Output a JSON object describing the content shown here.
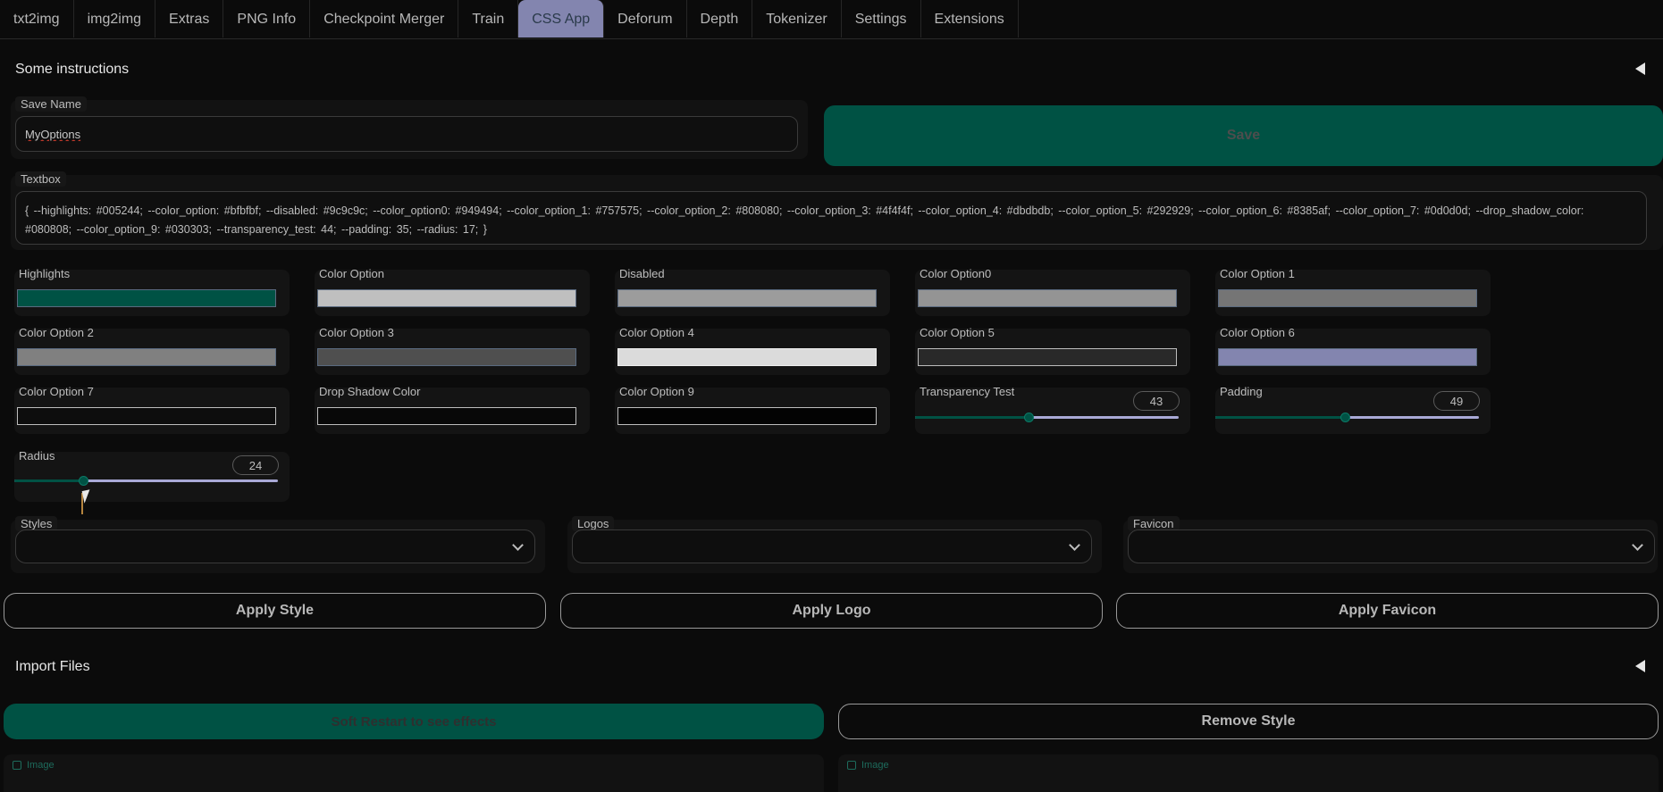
{
  "tabs": [
    {
      "label": "txt2img"
    },
    {
      "label": "img2img"
    },
    {
      "label": "Extras"
    },
    {
      "label": "PNG Info"
    },
    {
      "label": "Checkpoint Merger"
    },
    {
      "label": "Train"
    },
    {
      "label": "CSS App",
      "active": true
    },
    {
      "label": "Deforum"
    },
    {
      "label": "Depth"
    },
    {
      "label": "Tokenizer"
    },
    {
      "label": "Settings"
    },
    {
      "label": "Extensions"
    }
  ],
  "instructions": {
    "title": "Some instructions",
    "icon": "collapse-triangle-icon"
  },
  "save_name": {
    "label": "Save Name",
    "value": "MyOptions"
  },
  "save_button": {
    "label": "Save"
  },
  "textbox": {
    "label": "Textbox",
    "value": "{ --highlights:  #005244; --color_option:  #bfbfbf; --disabled:  #9c9c9c; --color_option0:  #949494; --color_option_1:  #757575; --color_option_2:  #808080; --color_option_3:  #4f4f4f; --color_option_4:  #dbdbdb; --color_option_5:  #292929; --color_option_6:  #8385af; --color_option_7:  #0d0d0d; --drop_shadow_color:  #080808; --color_option_9:  #030303; --transparency_test:  44; --padding:  35; --radius: 17; }"
  },
  "colors": [
    {
      "label": "Highlights",
      "color": "#005244"
    },
    {
      "label": "Color Option",
      "color": "#bfbfbf"
    },
    {
      "label": "Disabled",
      "color": "#9c9c9c"
    },
    {
      "label": "Color Option0",
      "color": "#949494"
    },
    {
      "label": "Color Option 1",
      "color": "#757575"
    },
    {
      "label": "Color Option 2",
      "color": "#808080"
    },
    {
      "label": "Color Option 3",
      "color": "#4f4f4f"
    },
    {
      "label": "Color Option 4",
      "color": "#dbdbdb"
    },
    {
      "label": "Color Option 5",
      "color": "#292929"
    },
    {
      "label": "Color Option 6",
      "color": "#8385af"
    },
    {
      "label": "Color Option 7",
      "color": "#0d0d0d"
    },
    {
      "label": "Drop Shadow Color",
      "color": "#080808"
    },
    {
      "label": "Color Option 9",
      "color": "#030303"
    }
  ],
  "sliders": {
    "transparency": {
      "label": "Transparency Test",
      "value": "43",
      "fraction": 0.43
    },
    "padding": {
      "label": "Padding",
      "value": "49",
      "fraction": 0.49
    },
    "radius": {
      "label": "Radius",
      "value": "24",
      "fraction": 0.26
    }
  },
  "dropdowns": {
    "styles": {
      "label": "Styles",
      "value": ""
    },
    "logos": {
      "label": "Logos",
      "value": ""
    },
    "favicon": {
      "label": "Favicon",
      "value": ""
    }
  },
  "apply_buttons": {
    "style": "Apply Style",
    "logo": "Apply Logo",
    "favicon": "Apply Favicon"
  },
  "import": {
    "title": "Import Files",
    "icon": "collapse-triangle-icon"
  },
  "restart_button": "Soft Restart to see effects",
  "remove_button": "Remove Style",
  "image_panels": [
    {
      "label": "Image"
    },
    {
      "label": "Image"
    }
  ],
  "accent": {
    "highlight": "#005244",
    "active_tab": "#8385af",
    "slider_track": "#a9a9d6"
  }
}
